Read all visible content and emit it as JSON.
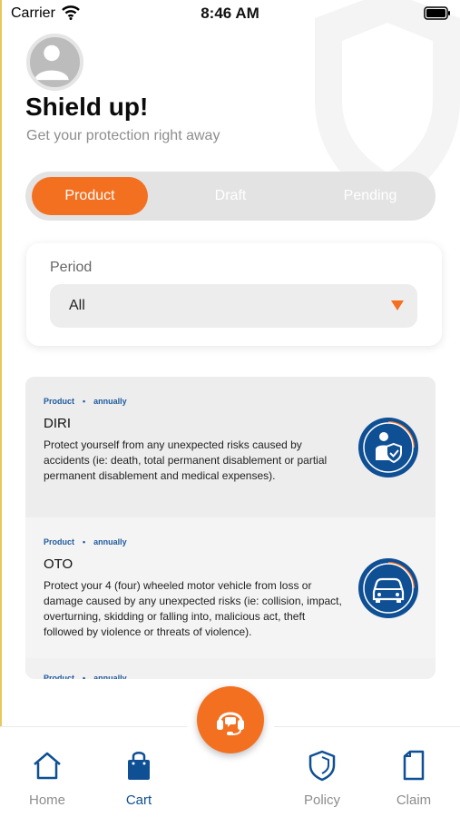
{
  "status_bar": {
    "carrier": "Carrier",
    "time": "8:46 AM"
  },
  "header": {
    "title": "Shield up!",
    "subtitle": "Get your protection right away"
  },
  "tabs": [
    {
      "label": "Product",
      "active": true
    },
    {
      "label": "Draft",
      "active": false
    },
    {
      "label": "Pending",
      "active": false
    }
  ],
  "filter": {
    "label": "Period",
    "selected": "All"
  },
  "products": [
    {
      "category": "Product",
      "frequency": "annually",
      "name": "DIRI",
      "description": "Protect yourself from any unexpected risks caused by accidents (ie: death, total permanent disablement or partial permanent disablement and medical expenses).",
      "icon": "personal-protection-icon"
    },
    {
      "category": "Product",
      "frequency": "annually",
      "name": "OTO",
      "description": "Protect your 4 (four) wheeled motor vehicle from loss or damage caused by any unexpected risks (ie: collision, impact, overturning, skidding or falling into, malicious act, theft followed by violence or threats of violence).",
      "icon": "car-icon"
    }
  ],
  "nav": {
    "home": "Home",
    "cart": "Cart",
    "policy": "Policy",
    "claim": "Claim",
    "active": "cart",
    "center_icon": "customer-service-headset-icon"
  },
  "colors": {
    "accent": "#f37021",
    "brand_blue": "#0f4f94",
    "muted": "#8d8d8d"
  }
}
